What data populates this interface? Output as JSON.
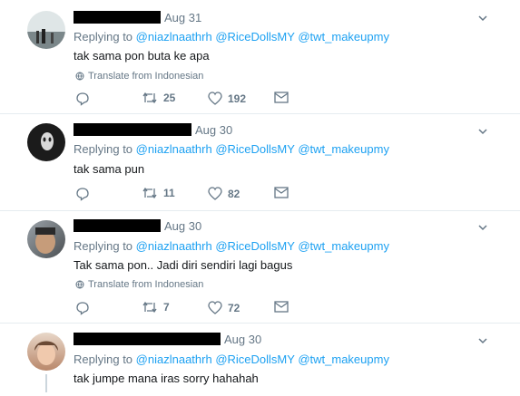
{
  "tweets": [
    {
      "date": "Aug 31",
      "replying_prefix": "Replying to",
      "mentions": [
        "@niazlnaathrh",
        "@RiceDollsMY",
        "@twt_makeupmy"
      ],
      "text": "tak sama pon buta ke apa",
      "translate": "Translate from Indonesian",
      "retweets": "25",
      "likes": "192"
    },
    {
      "date": "Aug 30",
      "replying_prefix": "Replying to",
      "mentions": [
        "@niazlnaathrh",
        "@RiceDollsMY",
        "@twt_makeupmy"
      ],
      "text": "tak sama pun",
      "translate": "",
      "retweets": "11",
      "likes": "82"
    },
    {
      "date": "Aug 30",
      "replying_prefix": "Replying to",
      "mentions": [
        "@niazlnaathrh",
        "@RiceDollsMY",
        "@twt_makeupmy"
      ],
      "text": "Tak sama pon.. Jadi diri sendiri lagi bagus",
      "translate": "Translate from Indonesian",
      "retweets": "7",
      "likes": "72"
    },
    {
      "date": "Aug 30",
      "replying_prefix": "Replying to",
      "mentions": [
        "@niazlnaathrh",
        "@RiceDollsMY",
        "@twt_makeupmy"
      ],
      "text": "tak jumpe mana iras sorry hahahah",
      "translate": "",
      "retweets": "",
      "likes": ""
    }
  ],
  "colors": {
    "link": "#1da1f2",
    "muted": "#657786",
    "border": "#e6ecf0"
  },
  "icons": [
    "reply-icon",
    "retweet-icon",
    "like-icon",
    "direct-message-icon",
    "chevron-down-icon",
    "globe-icon"
  ]
}
